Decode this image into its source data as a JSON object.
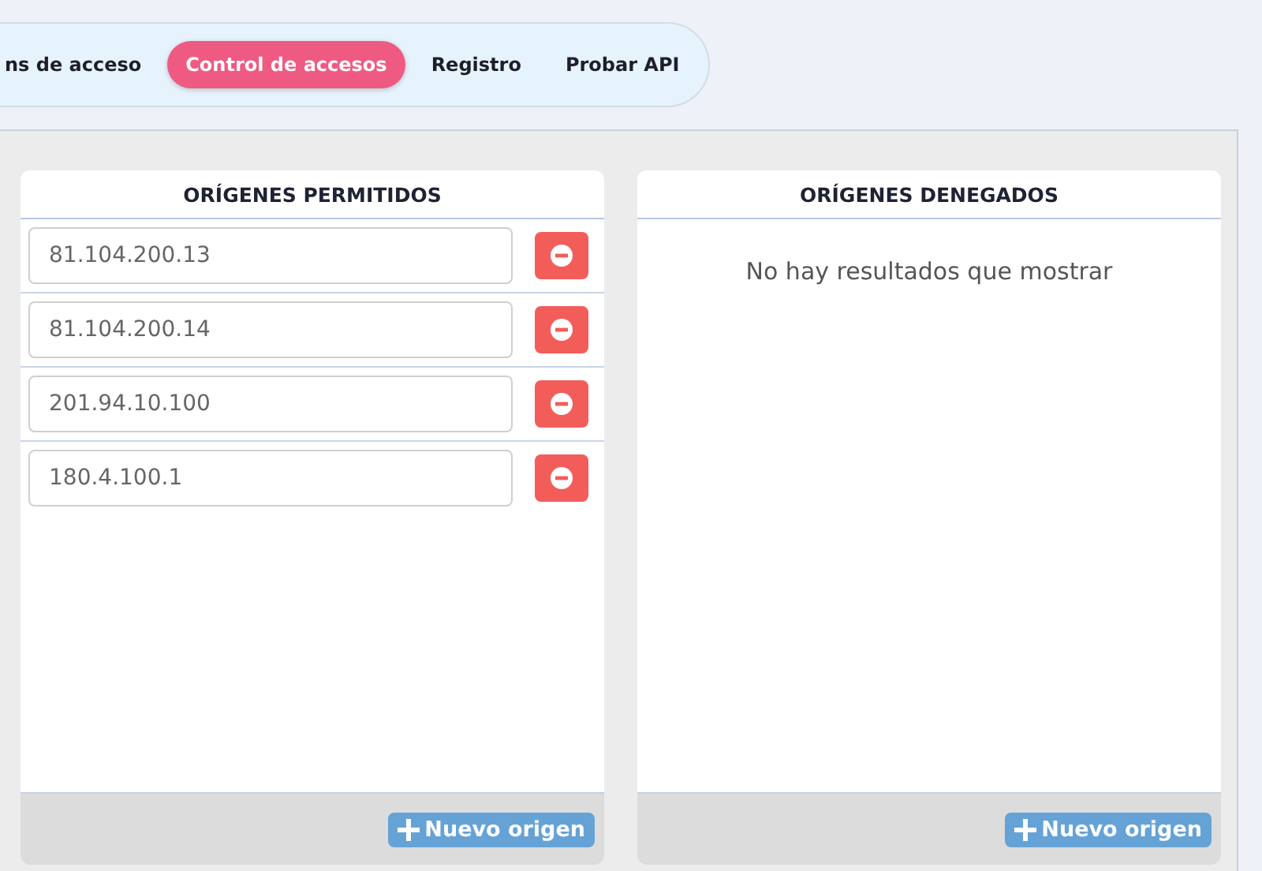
{
  "tabs": [
    {
      "label": "ns de acceso",
      "selected": false
    },
    {
      "label": "Control de accesos",
      "selected": true
    },
    {
      "label": "Registro",
      "selected": false
    },
    {
      "label": "Probar API",
      "selected": false
    }
  ],
  "allowed": {
    "title": "ORÍGENES PERMITIDOS",
    "origins": [
      {
        "value": "81.104.200.13"
      },
      {
        "value": "81.104.200.14"
      },
      {
        "value": "201.94.10.100"
      },
      {
        "value": "180.4.100.1"
      }
    ],
    "add_button": "Nuevo origen"
  },
  "denied": {
    "title": "ORÍGENES DENEGADOS",
    "empty_message": "No hay resultados que mostrar",
    "add_button": "Nuevo origen"
  }
}
